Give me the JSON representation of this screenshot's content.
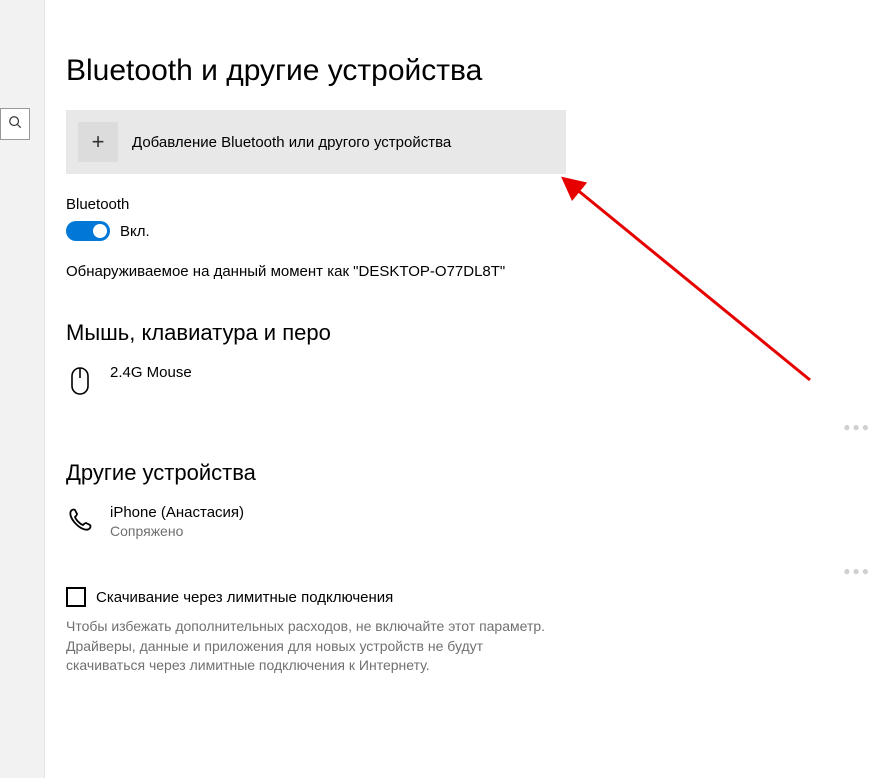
{
  "page": {
    "title": "Bluetooth и другие устройства"
  },
  "add_device": {
    "label": "Добавление Bluetooth или другого устройства",
    "icon_glyph": "+"
  },
  "bluetooth": {
    "label": "Bluetooth",
    "toggle_state": "Вкл.",
    "discoverable_text": "Обнаруживаемое на данный момент как \"DESKTOP-O77DL8T\""
  },
  "sections": {
    "mouse_keyboard_pen": {
      "heading": "Мышь, клавиатура и перо",
      "devices": [
        {
          "name": "2.4G Mouse",
          "icon": "mouse"
        }
      ]
    },
    "other_devices": {
      "heading": "Другие устройства",
      "devices": [
        {
          "name": "iPhone (Анастасия)",
          "status": "Сопряжено",
          "icon": "phone"
        }
      ]
    }
  },
  "metered": {
    "checkbox_label": "Скачивание через лимитные подключения",
    "description": "Чтобы избежать дополнительных расходов, не включайте этот параметр. Драйверы, данные и приложения для новых устройств не будут скачиваться через лимитные подключения к Интернету."
  },
  "annotation": {
    "arrow_color": "#e60000"
  }
}
